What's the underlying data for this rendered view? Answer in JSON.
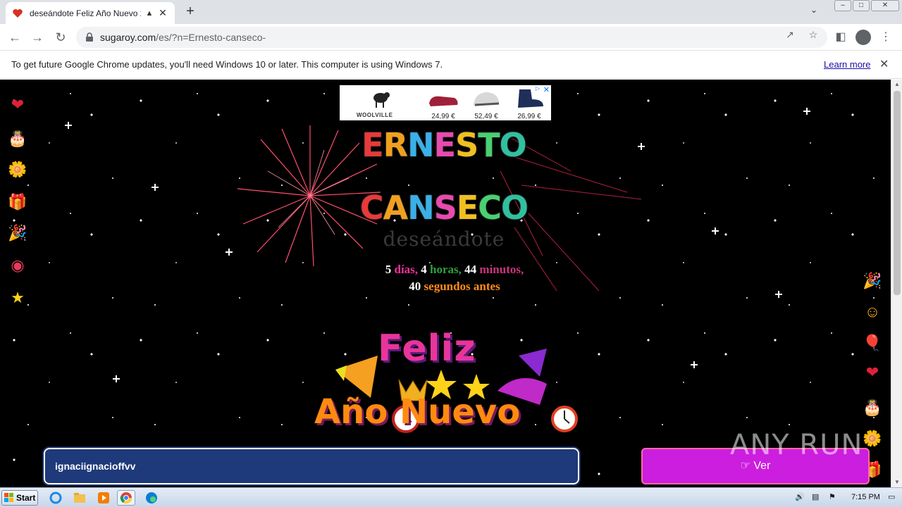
{
  "browser": {
    "tab_title": "deseándote Feliz Año Nuevo 20",
    "url_domain": "sugaroy.com",
    "url_path": "/es/?n=Ernesto-canseco-",
    "infobar_message": "To get future Google Chrome updates, you'll need Windows 10 or later. This computer is using Windows 7.",
    "infobar_link": "Learn more"
  },
  "ad": {
    "brand": "WOOLVILLE",
    "prices": [
      "24,99 €",
      "52,49 €",
      "26,99 €"
    ]
  },
  "greeting": {
    "first_name": [
      "E",
      "R",
      "N",
      "E",
      "S",
      "T",
      "O"
    ],
    "last_name": [
      "C",
      "A",
      "N",
      "S",
      "E",
      "C",
      "O"
    ],
    "subtitle": "deseándote",
    "countdown": {
      "days_num": "5",
      "days_label": "días,",
      "hours_num": "4",
      "hours_label": "horas,",
      "minutes_num": "44",
      "minutes_label": "minutos,",
      "seconds_num": "40",
      "seconds_label": "segundos antes"
    },
    "banner_line1": "Feliz",
    "banner_line2": "Año Nuevo"
  },
  "form": {
    "name_value": "ignaciignacioffvv",
    "button_label": "Ver"
  },
  "watermark": "ANY RUN",
  "taskbar": {
    "start_label": "Start",
    "clock": "7:15 PM"
  },
  "colors": {
    "name_letters": [
      "#e83a3a",
      "#f0a020",
      "#3ab0e8",
      "#e84ab0",
      "#f0c020",
      "#4ad070",
      "#30c0a0"
    ],
    "countdown_labels": [
      "#e8359b",
      "#2e9e3e",
      "#c8357b",
      "#ff8c1a"
    ],
    "input_bg": "#1e3a7a",
    "button_bg": "#cc1edf"
  }
}
